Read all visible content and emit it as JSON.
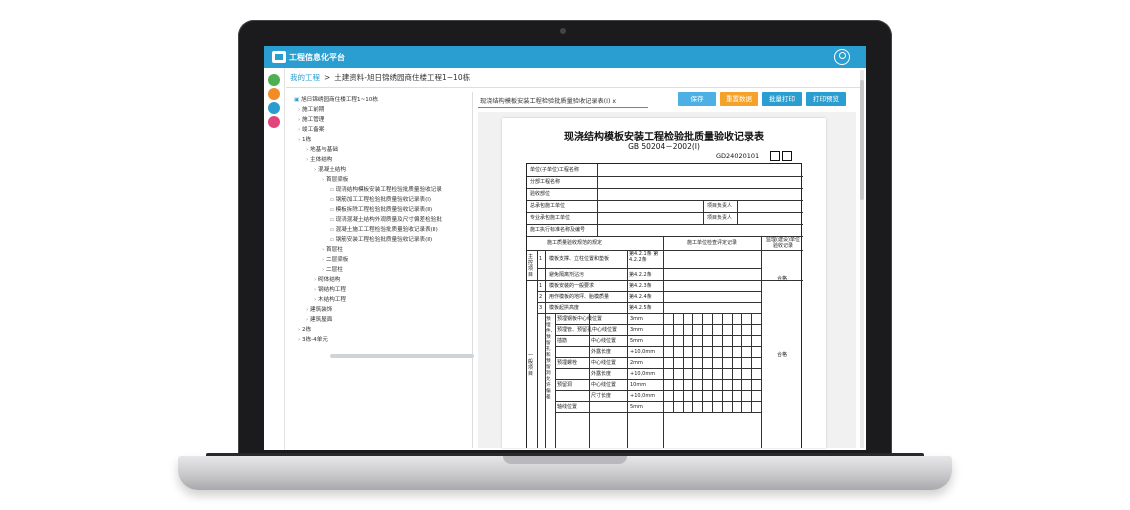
{
  "app": {
    "title": "工程信息化平台"
  },
  "breadcrumb": {
    "home": "我的工程",
    "sep": ">",
    "current": "土建资料-旭日锦绣园商住楼工程1~10栋"
  },
  "tree": {
    "root": "旭日锦绣园商住楼工程1~10栋",
    "items": [
      {
        "label": "施工前期",
        "indent": 0
      },
      {
        "label": "施工管理",
        "indent": 0
      },
      {
        "label": "竣工备案",
        "indent": 0
      },
      {
        "label": "1栋",
        "indent": 0
      },
      {
        "label": "地基与基础",
        "indent": 1
      },
      {
        "label": "主体结构",
        "indent": 1
      },
      {
        "label": "混凝土结构",
        "indent": 2
      },
      {
        "label": "首层梁板",
        "indent": 3
      },
      {
        "label": "现浇结构模板安装工程检验批质量验收记录",
        "indent": 4
      },
      {
        "label": "钢筋加工工程检验批质量验收记录表(Ⅰ)",
        "indent": 4
      },
      {
        "label": "模板拆除工程检验批质量验收记录表(Ⅱ)",
        "indent": 4
      },
      {
        "label": "现浇混凝土结构外观质量及尺寸偏差检验批",
        "indent": 4
      },
      {
        "label": "混凝土施工工程检验批质量验收记录表(Ⅱ)",
        "indent": 4
      },
      {
        "label": "钢筋安装工程检验批质量验收记录表(Ⅱ)",
        "indent": 4
      },
      {
        "label": "首层柱",
        "indent": 3
      },
      {
        "label": "二层梁板",
        "indent": 3
      },
      {
        "label": "二层柱",
        "indent": 3
      },
      {
        "label": "砌体结构",
        "indent": 2
      },
      {
        "label": "钢结构工程",
        "indent": 2
      },
      {
        "label": "木结构工程",
        "indent": 2
      },
      {
        "label": "建筑装饰",
        "indent": 1
      },
      {
        "label": "建筑屋面",
        "indent": 1
      },
      {
        "label": "2栋",
        "indent": 0
      },
      {
        "label": "3栋-4单元",
        "indent": 0
      }
    ]
  },
  "main": {
    "tab_title": "现浇结构模板安装工程检验批质量验收记录表(Ⅰ)",
    "tab_close": "x",
    "buttons": {
      "save": "保存",
      "reset": "重置数据",
      "batch_print": "批量打印",
      "print_preview": "打印预览"
    }
  },
  "document": {
    "title": "现浇结构模板安装工程检验批质量验收记录表",
    "standard": "GB 50204－2002(Ⅰ)",
    "code": "GD24020101",
    "header_rows": [
      "单位(子单位)工程名称",
      "分部工程名称",
      "验收部位",
      "总承包施工单位",
      "专业承包施工单位",
      "施工执行标准名称及编号"
    ],
    "manager_label": "项目负责人",
    "col_headers": {
      "spec": "施工质量验收规范的规定",
      "check": "施工单位检查评定记录",
      "supervision": "监理(建设)单位验收记录"
    },
    "main_control_label": "主控项目",
    "main_items": [
      {
        "no": "1",
        "name": "模板支撑、立柱位置和垫板",
        "clause": "第4.2.1条 第4.2.2条"
      }
    ],
    "general_items": [
      {
        "no": "1",
        "name": "模板安装的一般要求",
        "clause": "第4.2.3条"
      },
      {
        "no": "2",
        "name": "用作模板的地坪、胎模质量",
        "clause": "第4.2.4条"
      },
      {
        "no": "3",
        "name": "模板起拱高度",
        "clause": "第4.2.5条"
      }
    ],
    "isolation_label": "避免隔离剂沾污",
    "isolation_clause": "第4.2.2条",
    "group_label": "预埋件、预留孔和预留洞允许偏差",
    "deviation_rows": [
      {
        "name": "预埋钢板中心线位置",
        "sub": "",
        "val": "3mm"
      },
      {
        "name": "预埋管、预留孔中心线位置",
        "sub": "",
        "val": "3mm"
      },
      {
        "name": "插筋",
        "sub": "中心线位置",
        "val": "5mm"
      },
      {
        "name": "",
        "sub": "外露长度",
        "val": "+10,0mm"
      },
      {
        "name": "预埋螺栓",
        "sub": "中心线位置",
        "val": "2mm"
      },
      {
        "name": "",
        "sub": "外露长度",
        "val": "+10,0mm"
      },
      {
        "name": "预留洞",
        "sub": "中心线位置",
        "val": "10mm"
      },
      {
        "name": "",
        "sub": "尺寸长度",
        "val": "+10,0mm"
      },
      {
        "name": "轴线位置",
        "sub": "",
        "val": "5mm"
      }
    ],
    "general_label": "一般项目",
    "result_main": "合格",
    "result_general": "合格"
  }
}
